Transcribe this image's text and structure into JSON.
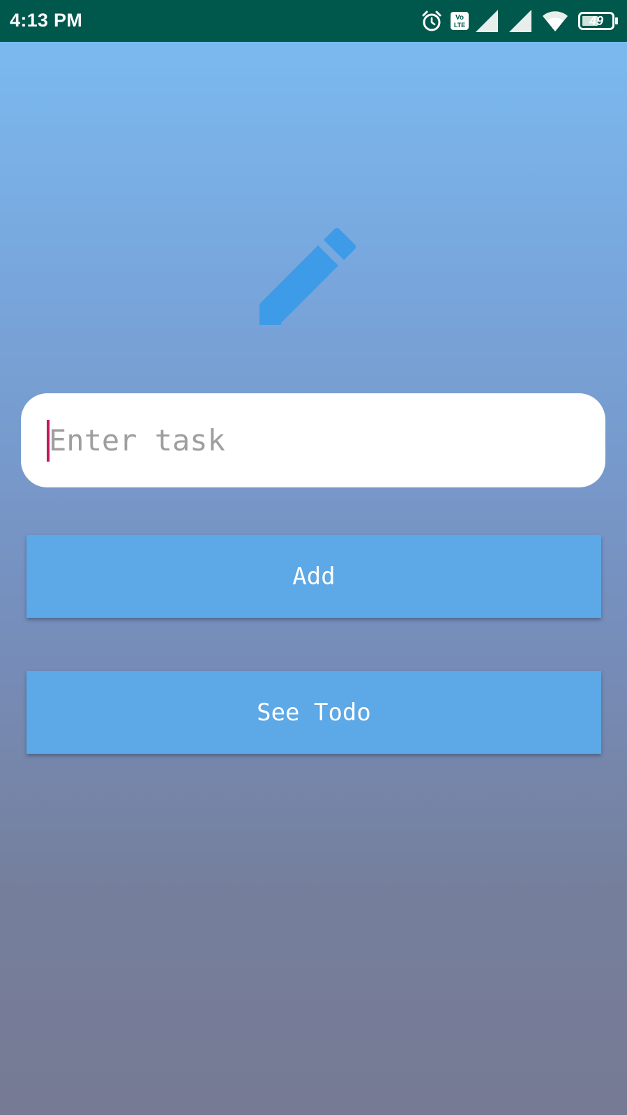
{
  "status_bar": {
    "time": "4:13 PM",
    "battery_level": "49",
    "icons": [
      "alarm-icon",
      "volte-icon",
      "signal-icon",
      "signal-icon",
      "wifi-icon",
      "battery-icon"
    ],
    "background_color": "#00574b"
  },
  "header": {
    "icon": "pencil-icon",
    "icon_color": "#3d9be8"
  },
  "task_input": {
    "placeholder": "Enter task",
    "value": ""
  },
  "buttons": {
    "add_label": "Add",
    "see_todo_label": "See Todo",
    "color": "#5da8e6"
  }
}
